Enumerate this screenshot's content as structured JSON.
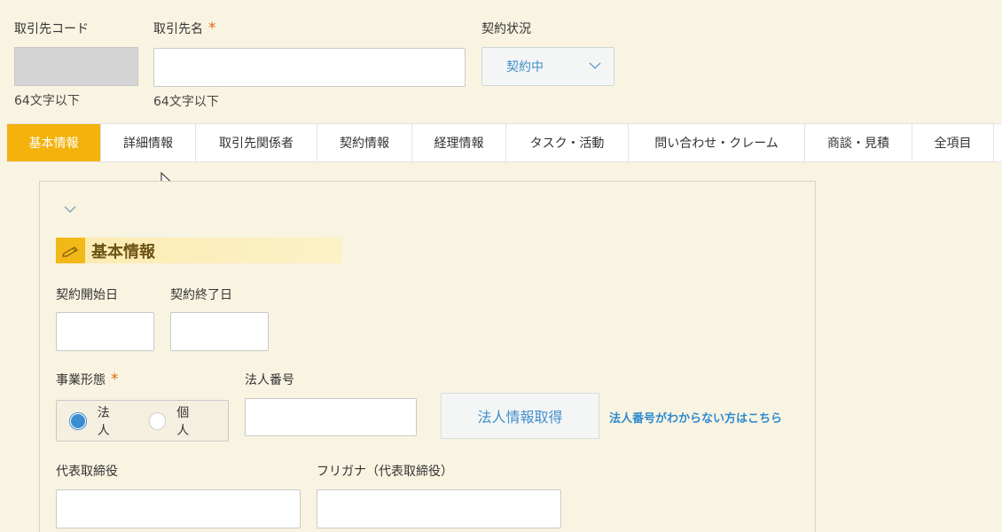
{
  "top_fields": {
    "code_label": "取引先コード",
    "code_hint": "64文字以下",
    "name_label": "取引先名",
    "name_required_mark": "*",
    "name_hint": "64文字以下",
    "status_label": "契約状況",
    "status_value": "契約中"
  },
  "tabs": [
    {
      "label": "基本情報",
      "active": true
    },
    {
      "label": "詳細情報"
    },
    {
      "label": "取引先関係者"
    },
    {
      "label": "契約情報"
    },
    {
      "label": "経理情報"
    },
    {
      "label": "タスク・活動"
    },
    {
      "label": "問い合わせ・クレーム"
    },
    {
      "label": "商談・見積"
    },
    {
      "label": "全項目"
    }
  ],
  "section": {
    "title": "基本情報",
    "contract_start_label": "契約開始日",
    "contract_end_label": "契約終了日",
    "business_form_label": "事業形態",
    "business_form_required_mark": "*",
    "business_form_options": [
      "法人",
      "個人"
    ],
    "business_form_selected": "法人",
    "corp_number_label": "法人番号",
    "fetch_button_label": "法人情報取得",
    "help_link_label": "法人番号がわからない方はこちら",
    "representative_label": "代表取締役",
    "representative_kana_label": "フリガナ（代表取締役）"
  },
  "colors": {
    "background": "#f9f3e1",
    "active_tab": "#f3b20c",
    "accent_blue": "#3a8ed0",
    "required": "#e0671e"
  }
}
